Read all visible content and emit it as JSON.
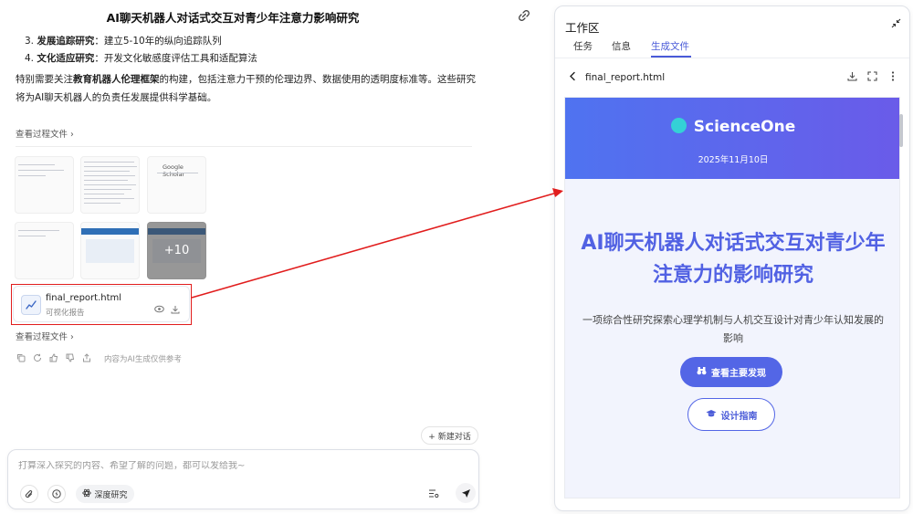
{
  "chat": {
    "title": "AI聊天机器人对话式交互对青少年注意力影响研究",
    "list_items": [
      {
        "number": "3.",
        "label": "发展追踪研究",
        "text": "：建立5-10年的纵向追踪队列"
      },
      {
        "number": "4.",
        "label": "文化适应研究",
        "text": "：开发文化敏感度评估工具和适配算法"
      }
    ],
    "paragraph": {
      "pre": "特别需要关注",
      "bold": "教育机器人伦理框架",
      "post": "的构建，包括注意力干预的伦理边界、数据使用的透明度标准等。这些研究将为AI聊天机器人的负责任发展提供科学基础。"
    },
    "process_link_1": "查看过程文件 ›",
    "process_link_2": "查看过程文件 ›",
    "thumbnail_text": "Google Scholar",
    "more_thumbnails": "+10",
    "file_card": {
      "name": "final_report.html",
      "subtitle": "可视化报告"
    },
    "disclaimer": "内容为AI生成仅供参考",
    "new_chat_label": "+ 新建对话",
    "input": {
      "placeholder": "打算深入探究的内容、希望了解的问题，都可以发给我~",
      "value": ""
    },
    "deep_research_label": "深度研究"
  },
  "workspace": {
    "title": "工作区",
    "tabs": [
      {
        "label": "任务",
        "active": false
      },
      {
        "label": "信息",
        "active": false
      },
      {
        "label": "生成文件",
        "active": true
      }
    ],
    "file_bar": {
      "file_name": "final_report.html"
    },
    "preview": {
      "brand": "ScienceOne",
      "date": "2025年11月10日",
      "title": "AI聊天机器人对话式交互对青少年注意力的影响研究",
      "subtitle": "一项综合性研究探索心理学机制与人机交互设计对青少年认知发展的影响",
      "primary_button": "查看主要发现",
      "secondary_button": "设计指南"
    }
  },
  "colors": {
    "accent": "#4a5bd8",
    "header_gradient_start": "#4f73f0",
    "header_gradient_end": "#6a5be9",
    "annotation_red": "#e11d1d",
    "hero_background": "#f2f4fd"
  },
  "icons": [
    "link-icon",
    "chart-file-icon",
    "eye-icon",
    "download-icon",
    "copy-icon",
    "refresh-icon",
    "thumbs-up-icon",
    "thumbs-down-icon",
    "share-icon",
    "attach-icon",
    "lightning-icon",
    "atom-icon",
    "tools-icon",
    "send-icon",
    "collapse-icon",
    "back-arrow-icon",
    "fullscreen-icon",
    "more-icon",
    "brain-icon",
    "binoculars-icon",
    "graduation-cap-icon"
  ]
}
